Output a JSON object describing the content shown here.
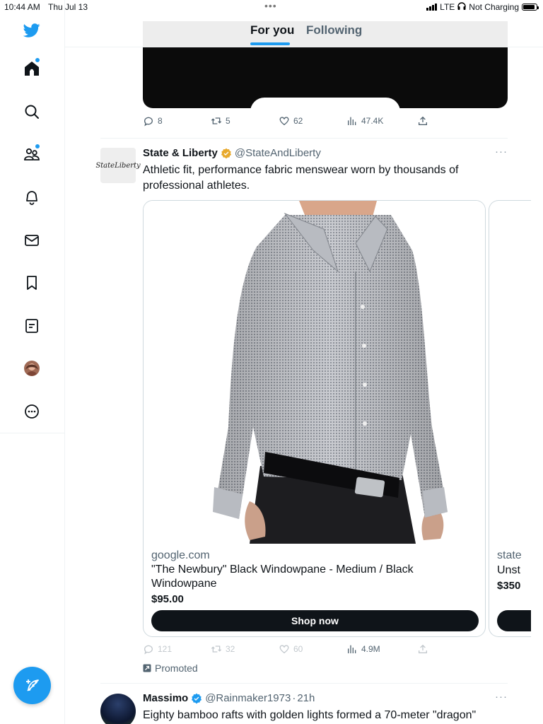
{
  "status_bar": {
    "time": "10:44 AM",
    "date": "Thu Jul 13",
    "network": "LTE",
    "charging": "Not Charging",
    "battery_level": 0.9
  },
  "top_tabs": {
    "for_you": "For you",
    "following": "Following",
    "active": "For you"
  },
  "sidebar": {
    "icons": [
      "twitter-logo-icon",
      "home-icon",
      "search-icon",
      "communities-icon",
      "notifications-icon",
      "messages-icon",
      "bookmarks-icon",
      "lists-icon",
      "profile-avatar",
      "more-icon"
    ],
    "compose_icon": "compose-feather-icon"
  },
  "prev_tweet": {
    "replies": "8",
    "retweets": "5",
    "likes": "62",
    "views": "47.4K"
  },
  "ad_tweet": {
    "avatar_text": "StateLiberty",
    "name": "State & Liberty",
    "handle": "@StateAndLiberty",
    "text": "Athletic fit, performance fabric menswear worn by thousands of professional athletes.",
    "card": {
      "domain": "google.com",
      "title": "\"The Newbury\" Black Windowpane - Medium / Black Windowpane",
      "price": "$95.00",
      "button": "Shop now"
    },
    "card2": {
      "domain": "state",
      "title": "Unst",
      "price": "$350"
    },
    "replies": "121",
    "retweets": "32",
    "likes": "60",
    "views": "4.9M",
    "promoted_label": "Promoted"
  },
  "next_tweet": {
    "name": "Massimo",
    "handle": "@Rainmaker1973",
    "time": "21h",
    "text": "Eighty bamboo rafts with golden lights formed a 70-meter \"dragon\""
  },
  "colors": {
    "accent": "#1d9bf0",
    "text": "#0f1419",
    "muted": "#536471",
    "verified_gold": "#e8a92c"
  }
}
